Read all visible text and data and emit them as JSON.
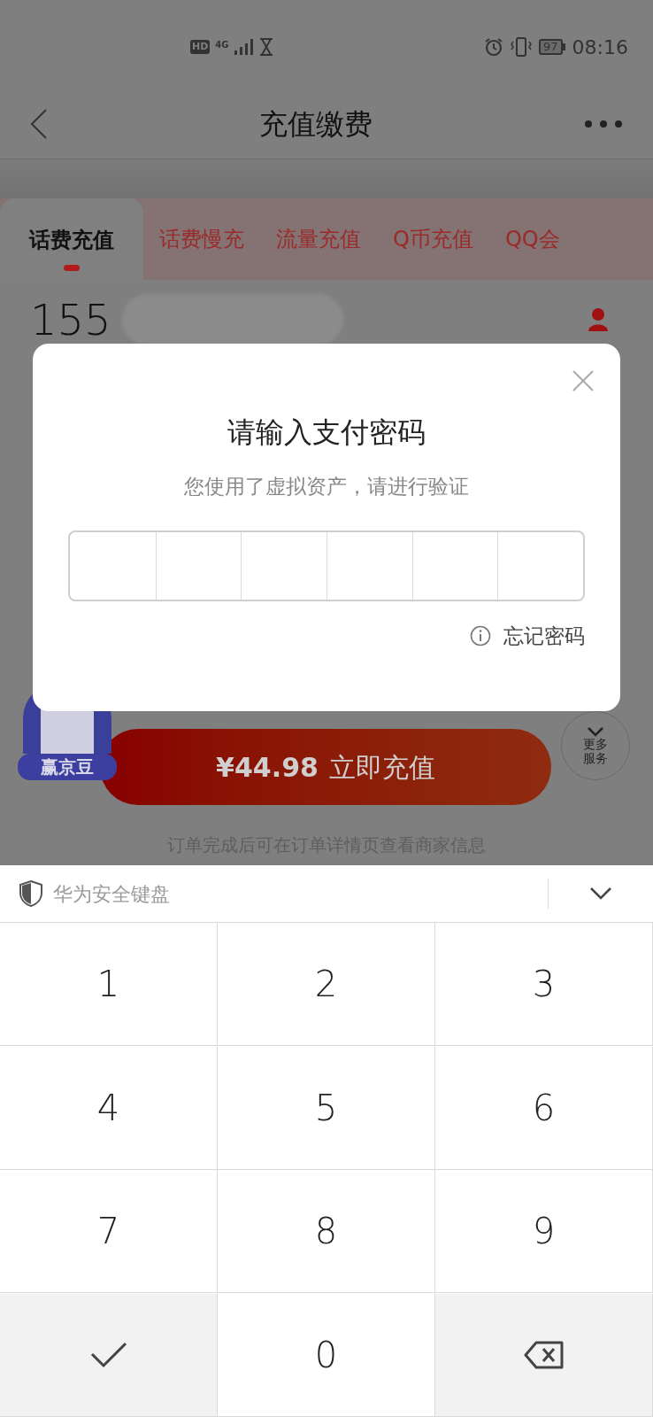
{
  "status_bar": {
    "hd": "HD",
    "network": "4G",
    "battery": "97",
    "time": "08:16"
  },
  "header": {
    "title": "充值缴费"
  },
  "tabs": [
    {
      "label": "话费充值",
      "selected": true
    },
    {
      "label": "话费慢充",
      "selected": false
    },
    {
      "label": "流量充值",
      "selected": false
    },
    {
      "label": "Q币充值",
      "selected": false
    },
    {
      "label": "QQ会",
      "selected": false
    }
  ],
  "phone": {
    "number_prefix": "155"
  },
  "promo_badge": "赢京豆",
  "more_services": [
    "更多",
    "服务"
  ],
  "pay_button": {
    "price": "¥44.98",
    "label": "立即充值"
  },
  "notice": "订单完成后可在订单详情页查看商家信息",
  "dialog": {
    "title": "请输入支付密码",
    "subtitle": "您使用了虚拟资产，请进行验证",
    "cells": [
      {
        "filled": false
      },
      {
        "filled": false
      },
      {
        "filled": false
      },
      {
        "filled": false
      },
      {
        "filled": false
      },
      {
        "filled": false
      }
    ],
    "forgot_link": "忘记密码"
  },
  "keyboard": {
    "title": "华为安全键盘",
    "keys": [
      {
        "kind": "digit",
        "label": "1"
      },
      {
        "kind": "digit",
        "label": "2"
      },
      {
        "kind": "digit",
        "label": "3"
      },
      {
        "kind": "digit",
        "label": "4"
      },
      {
        "kind": "digit",
        "label": "5"
      },
      {
        "kind": "digit",
        "label": "6"
      },
      {
        "kind": "digit",
        "label": "7"
      },
      {
        "kind": "digit",
        "label": "8"
      },
      {
        "kind": "digit",
        "label": "9"
      },
      {
        "kind": "confirm"
      },
      {
        "kind": "digit",
        "label": "0"
      },
      {
        "kind": "backspace"
      }
    ]
  }
}
